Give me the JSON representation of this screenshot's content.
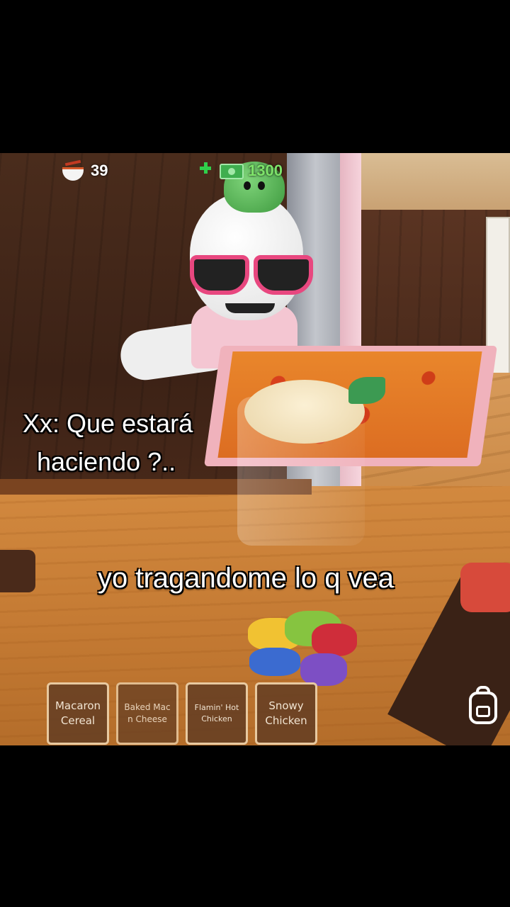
{
  "hud": {
    "bowls_count": "39",
    "cash_amount": "1300"
  },
  "captions": {
    "line1": "Xx: Que estará",
    "line2": "haciendo ?..",
    "center": "yo tragandome lo q vea"
  },
  "hotbar": {
    "slots": [
      {
        "label": "Macaron Cereal"
      },
      {
        "label": "Baked Mac n Cheese"
      },
      {
        "label": "Flamin' Hot Chicken"
      },
      {
        "label": "Snowy Chicken"
      }
    ]
  },
  "icons": {
    "bowl": "bowl-icon",
    "plus": "plus-icon",
    "cash": "cash-icon",
    "backpack": "backpack-icon"
  },
  "colors": {
    "cash_text": "#7ee36a",
    "slot_bg": "#5f3a22",
    "slot_border": "#e8c9a0"
  }
}
